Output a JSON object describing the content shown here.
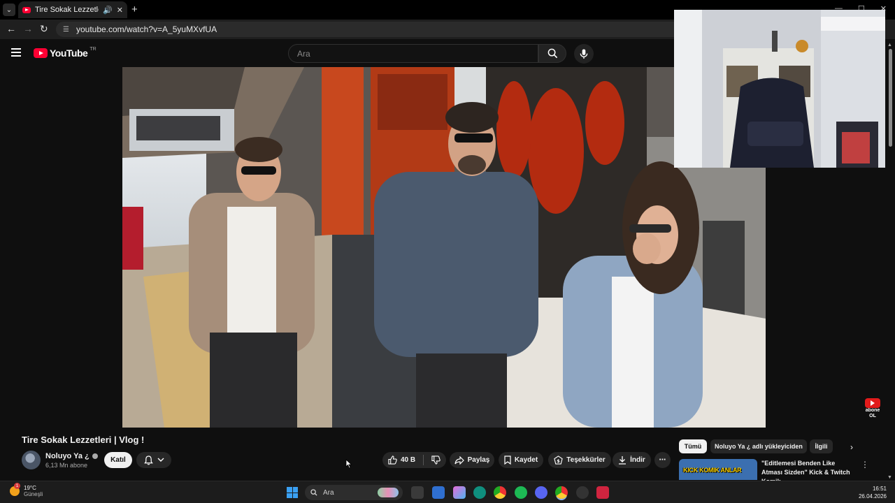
{
  "browser": {
    "tab_title": "Tire Sokak Lezzetleri | Vlog",
    "url": "youtube.com/watch?v=A_5yuMXvfUA"
  },
  "youtube": {
    "logo_text": "YouTube",
    "region": "TR",
    "search_placeholder": "Ara",
    "video": {
      "title": "Tire Sokak Lezzetleri | Vlog !",
      "channel": "Noluyo Ya ¿",
      "subscribers": "6,13 Mn abone",
      "join_label": "Katıl",
      "like_count": "40 B",
      "share_label": "Paylaş",
      "save_label": "Kaydet",
      "thanks_label": "Teşekkürler",
      "download_label": "İndir"
    },
    "overlay_badge": [
      "abone",
      "OL"
    ],
    "sidebar": {
      "chips": [
        "Tümü",
        "Noluyo Ya ¿ adlı yükleyiciden",
        "İlgili"
      ],
      "recommendation": {
        "thumbnail_text": "KICK KOMIK ANLAR",
        "title": "\"Editlemesi Benden Like Atması Sizden\" Kick & Twitch Komik ..."
      }
    }
  },
  "taskbar": {
    "weather_badge": "1",
    "weather_temp": "19°C",
    "weather_desc": "Güneşli",
    "search_placeholder": "Ara",
    "time": "16:51",
    "date": "26.04.2026"
  },
  "colors": {
    "youtube_red": "#ff0033",
    "background": "#0f0f0f",
    "pill": "#272727"
  }
}
